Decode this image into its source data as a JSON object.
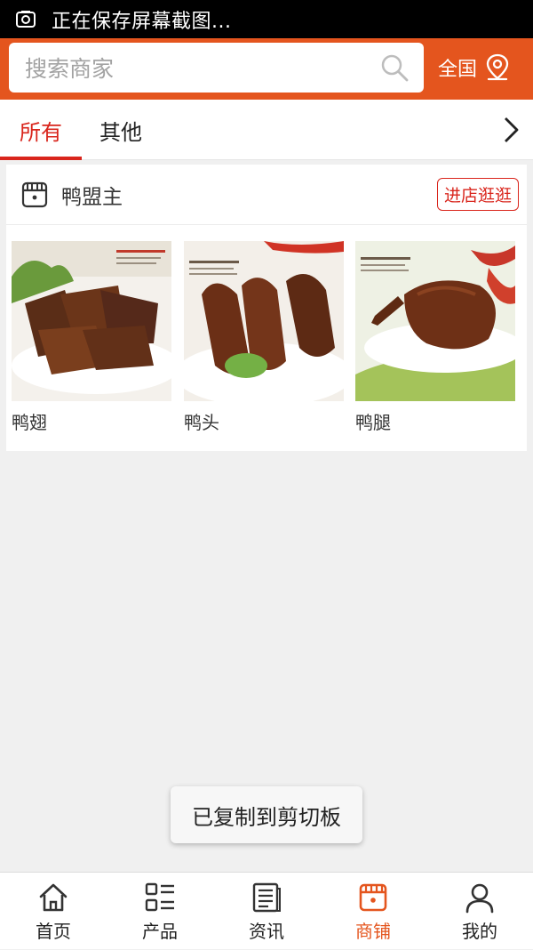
{
  "status_bar": {
    "text": "正在保存屏幕截图...",
    "icon": "screenshot-icon"
  },
  "header": {
    "search_placeholder": "搜索商家",
    "region_label": "全国",
    "accent_color": "#e4551e"
  },
  "tabs": [
    {
      "label": "所有",
      "active": true
    },
    {
      "label": "其他",
      "active": false
    }
  ],
  "store": {
    "name": "鸭盟主",
    "enter_button": "进店逛逛",
    "products": [
      {
        "name": "鸭翅"
      },
      {
        "name": "鸭头"
      },
      {
        "name": "鸭腿"
      }
    ]
  },
  "toast": {
    "text": "已复制到剪切板"
  },
  "bottom_nav": [
    {
      "label": "首页",
      "icon": "home-icon",
      "active": false
    },
    {
      "label": "产品",
      "icon": "grid-list-icon",
      "active": false
    },
    {
      "label": "资讯",
      "icon": "news-icon",
      "active": false
    },
    {
      "label": "商铺",
      "icon": "shop-icon",
      "active": true
    },
    {
      "label": "我的",
      "icon": "user-icon",
      "active": false
    }
  ]
}
